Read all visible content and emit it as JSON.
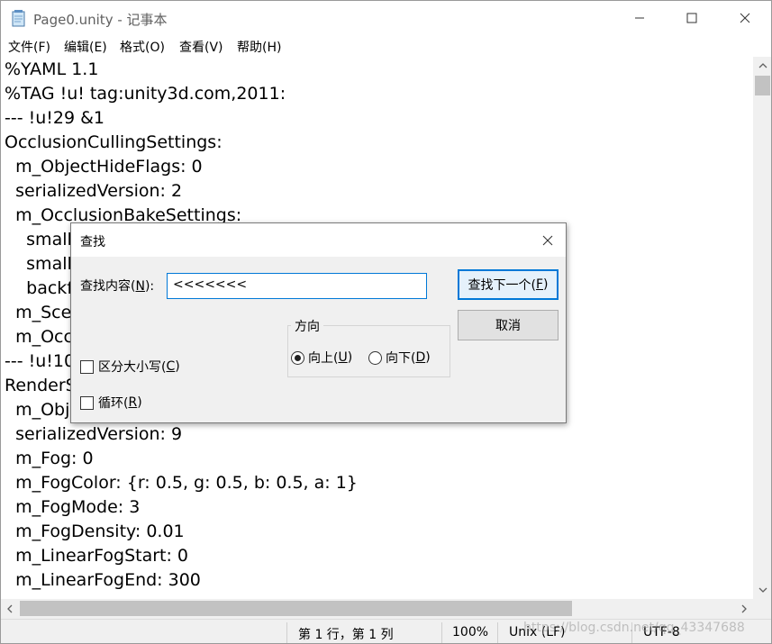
{
  "window": {
    "title": "Page0.unity - 记事本",
    "controls": {
      "minimize": "minimize-icon",
      "maximize": "maximize-icon",
      "close": "close-icon"
    }
  },
  "menu": {
    "items": [
      {
        "label": "文件(F)"
      },
      {
        "label": "编辑(E)"
      },
      {
        "label": "格式(O)"
      },
      {
        "label": "查看(V)"
      },
      {
        "label": "帮助(H)"
      }
    ]
  },
  "editor": {
    "lines": [
      "%YAML 1.1",
      "%TAG !u! tag:unity3d.com,2011:",
      "--- !u!29 &1",
      "OcclusionCullingSettings:",
      "  m_ObjectHideFlags: 0",
      "  serializedVersion: 2",
      "  m_OcclusionBakeSettings:",
      "    small",
      "    small",
      "    backf",
      "  m_Sce",
      "  m_Occ",
      "--- !u!10",
      "RenderS",
      "  m_Obj",
      "  serializedVersion: 9",
      "  m_Fog: 0",
      "  m_FogColor: {r: 0.5, g: 0.5, b: 0.5, a: 1}",
      "  m_FogMode: 3",
      "  m_FogDensity: 0.01",
      "  m_LinearFogStart: 0",
      "  m_LinearFogEnd: 300"
    ]
  },
  "statusbar": {
    "position": "第 1 行，第 1 列",
    "zoom": "100%",
    "line_ending": "Unix (LF)",
    "encoding": "UTF-8",
    "watermark": "https://blog.csdn.net/qq_43347688"
  },
  "find_dialog": {
    "title": "查找",
    "label": "查找内容(N):",
    "label_text": "查找内容(",
    "label_key": "N",
    "label_tail": "):",
    "value": "<<<<<<<",
    "find_next": {
      "text": "查找下一个(",
      "key": "F",
      "tail": ")"
    },
    "cancel": "取消",
    "direction": {
      "title": "方向",
      "up": {
        "text": "向上(",
        "key": "U",
        "tail": ")",
        "checked": true
      },
      "down": {
        "text": "向下(",
        "key": "D",
        "tail": ")",
        "checked": false
      }
    },
    "match_case": {
      "text": "区分大小写(",
      "key": "C",
      "tail": ")",
      "checked": false
    },
    "wrap": {
      "text": "循环(",
      "key": "R",
      "tail": ")",
      "checked": false
    }
  }
}
